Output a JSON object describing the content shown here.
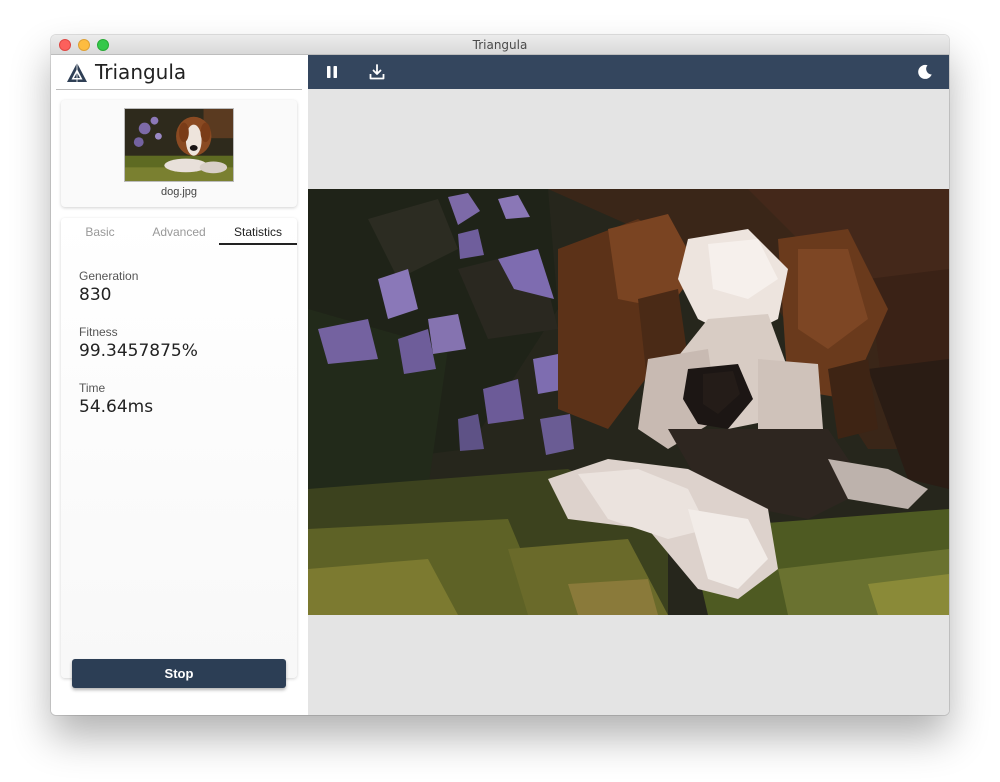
{
  "window": {
    "title": "Triangula"
  },
  "brand": {
    "name": "Triangula"
  },
  "image": {
    "file_name": "dog.jpg"
  },
  "tabs": [
    {
      "label": "Basic",
      "active": false
    },
    {
      "label": "Advanced",
      "active": false
    },
    {
      "label": "Statistics",
      "active": true
    }
  ],
  "stats": {
    "generation": {
      "label": "Generation",
      "value": "830"
    },
    "fitness": {
      "label": "Fitness",
      "value": "99.3457875%"
    },
    "time": {
      "label": "Time",
      "value": "54.64ms"
    }
  },
  "actions": {
    "stop_label": "Stop"
  },
  "toolbar": {
    "icons": [
      "pause-icon",
      "download-icon",
      "dark-mode-moon-icon"
    ]
  },
  "colors": {
    "toolbar_bg": "#34465e",
    "stop_button_bg": "#2c3e55",
    "canvas_bg": "#e4e4e4"
  }
}
